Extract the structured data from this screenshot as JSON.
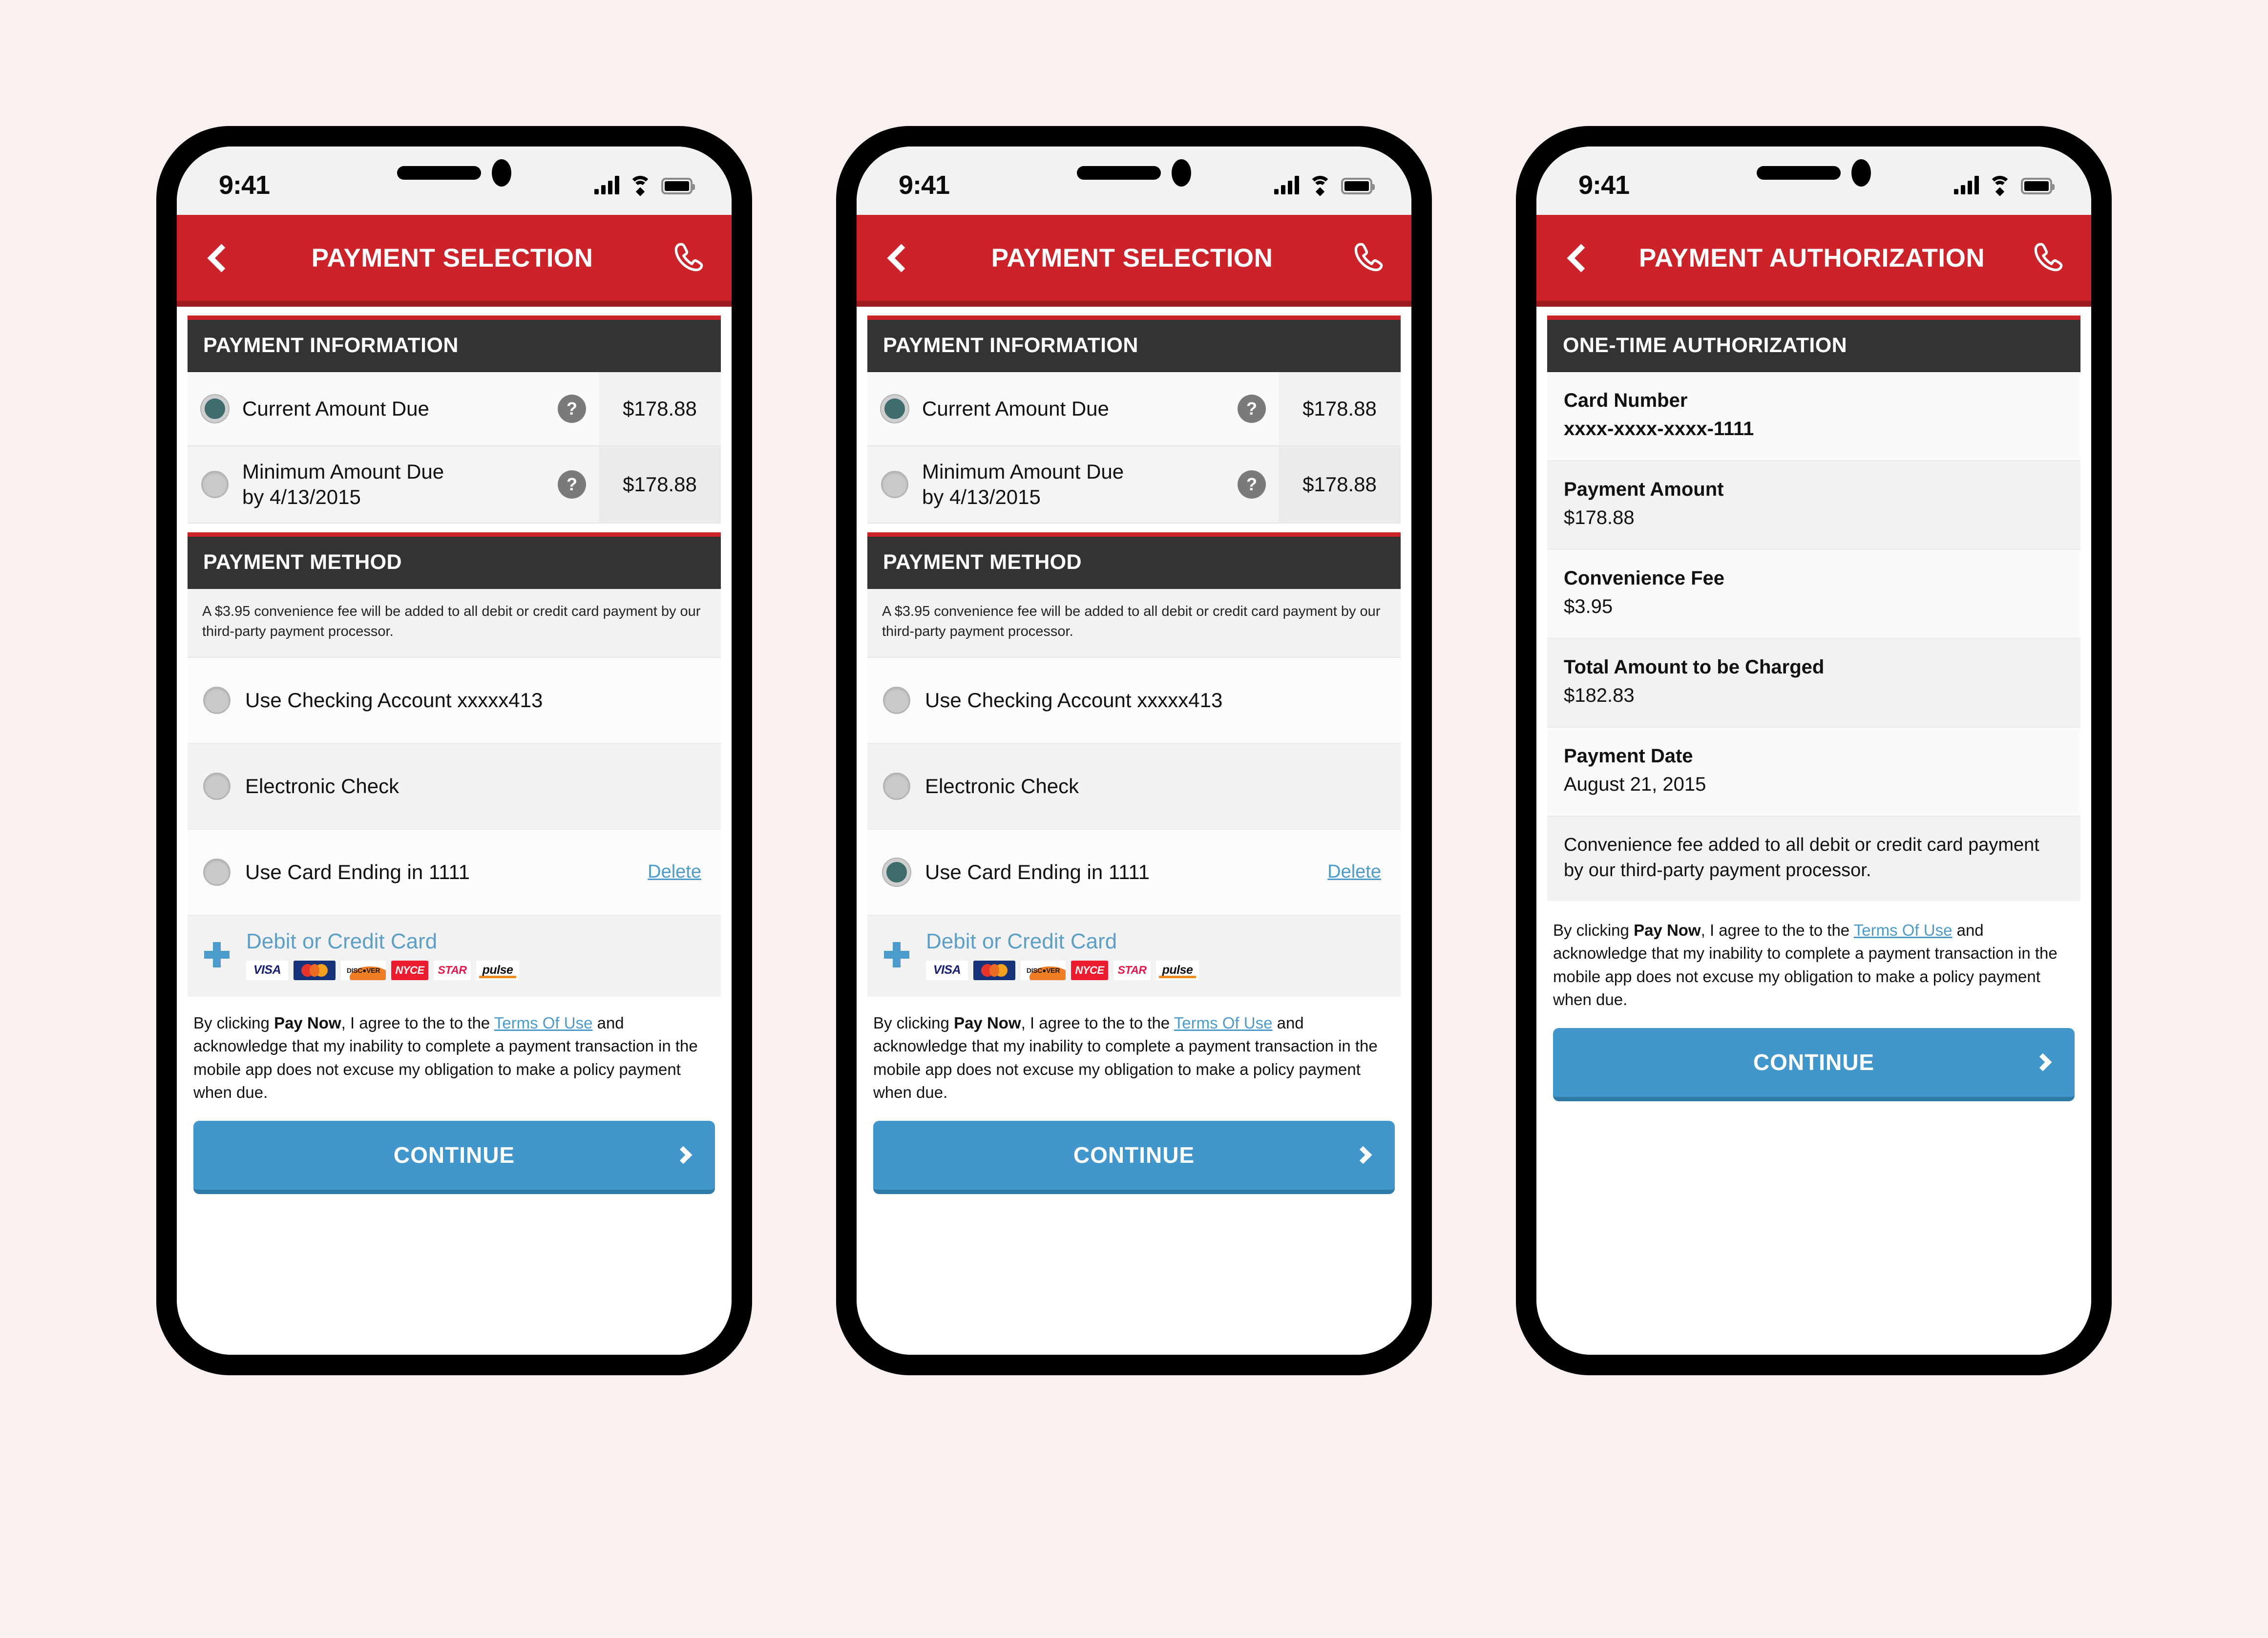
{
  "background_color": "#faf0ef",
  "accent": {
    "red": "#cc2229",
    "red_dark": "#9e1b20",
    "blue": "#4197cb",
    "link": "#4b9bcb",
    "radio_on": "#3e6b6b",
    "header_dark": "#333333"
  },
  "status_bar": {
    "time": "9:41",
    "signal_icon": "cellular-bars-icon",
    "wifi_icon": "wifi-icon",
    "battery_icon": "battery-full-icon"
  },
  "screens": [
    {
      "id": "payment-selection-a",
      "appbar": {
        "title": "PAYMENT SELECTION",
        "back_icon": "back-chevron-icon",
        "call_icon": "phone-call-icon"
      },
      "payment_information": {
        "header": "PAYMENT INFORMATION",
        "rows": [
          {
            "label": "Current Amount Due",
            "amount": "$178.88",
            "selected": true,
            "help_icon": "question-mark-icon"
          },
          {
            "label": "Minimum Amount Due\nby 4/13/2015",
            "amount": "$178.88",
            "selected": false,
            "help_icon": "question-mark-icon"
          }
        ]
      },
      "payment_method": {
        "header": "PAYMENT METHOD",
        "fee_note": "A $3.95 convenience fee will be added to all debit or credit card payment by our third-party payment processor.",
        "options": [
          {
            "label": "Use Checking Account xxxxx413",
            "selected": false,
            "delete_label": null
          },
          {
            "label": "Electronic Check",
            "selected": false,
            "delete_label": null
          },
          {
            "label": "Use Card Ending in 1111",
            "selected": false,
            "delete_label": "Delete"
          }
        ],
        "add_card": {
          "label": "Debit or Credit Card",
          "plus_icon": "plus-icon",
          "logos": [
            "VISA",
            "MasterCard",
            "DISCOVER",
            "NYCE",
            "STAR",
            "pulse"
          ]
        }
      },
      "terms": {
        "prefix": "By clicking ",
        "bold": "Pay Now",
        "middle": ", I agree to the to the ",
        "link": "Terms Of Use",
        "suffix": " and acknowledge that my inability to complete a payment transaction in the mobile app does not excuse my obligation to make a policy payment when due."
      },
      "continue_button": {
        "label": "CONTINUE",
        "chevron_icon": "chevron-right-icon"
      }
    },
    {
      "id": "payment-selection-b",
      "appbar": {
        "title": "PAYMENT SELECTION",
        "back_icon": "back-chevron-icon",
        "call_icon": "phone-call-icon"
      },
      "payment_information": {
        "header": "PAYMENT INFORMATION",
        "rows": [
          {
            "label": "Current Amount Due",
            "amount": "$178.88",
            "selected": true,
            "help_icon": "question-mark-icon"
          },
          {
            "label": "Minimum Amount Due\nby 4/13/2015",
            "amount": "$178.88",
            "selected": false,
            "help_icon": "question-mark-icon"
          }
        ]
      },
      "payment_method": {
        "header": "PAYMENT METHOD",
        "fee_note": "A $3.95 convenience fee will be added to all debit or credit card payment by our third-party payment processor.",
        "options": [
          {
            "label": "Use Checking Account xxxxx413",
            "selected": false,
            "delete_label": null
          },
          {
            "label": "Electronic Check",
            "selected": false,
            "delete_label": null
          },
          {
            "label": "Use Card Ending in 1111",
            "selected": true,
            "delete_label": "Delete"
          }
        ],
        "add_card": {
          "label": "Debit or Credit Card",
          "plus_icon": "plus-icon",
          "logos": [
            "VISA",
            "MasterCard",
            "DISCOVER",
            "NYCE",
            "STAR",
            "pulse"
          ]
        }
      },
      "terms": {
        "prefix": "By clicking ",
        "bold": "Pay Now",
        "middle": ", I agree to the to the ",
        "link": "Terms Of Use",
        "suffix": " and acknowledge that my inability to complete a payment transaction in the mobile app does not excuse my obligation to make a policy payment when due."
      },
      "continue_button": {
        "label": "CONTINUE",
        "chevron_icon": "chevron-right-icon"
      }
    },
    {
      "id": "payment-authorization",
      "appbar": {
        "title": "PAYMENT AUTHORIZATION",
        "back_icon": "back-chevron-icon",
        "call_icon": "phone-call-icon"
      },
      "authorization": {
        "header": "ONE-TIME AUTHORIZATION",
        "rows": [
          {
            "key": "Card Number",
            "value": "xxxx-xxxx-xxxx-1111"
          },
          {
            "key": "Payment Amount",
            "value": "$178.88"
          },
          {
            "key": "Convenience Fee",
            "value": "$3.95"
          },
          {
            "key": "Total Amount to be Charged",
            "value": "$182.83"
          },
          {
            "key": "Payment Date",
            "value": "August 21, 2015"
          }
        ],
        "note": "Convenience fee added to all debit or credit card payment by our third-party payment processor."
      },
      "terms": {
        "prefix": "By clicking ",
        "bold": "Pay Now",
        "middle": ", I agree to the to the ",
        "link": "Terms Of Use",
        "suffix": " and acknowledge that my inability to complete a payment transaction in the mobile app does not excuse my obligation to make a policy payment when due."
      },
      "continue_button": {
        "label": "CONTINUE",
        "chevron_icon": "chevron-right-icon"
      }
    }
  ]
}
